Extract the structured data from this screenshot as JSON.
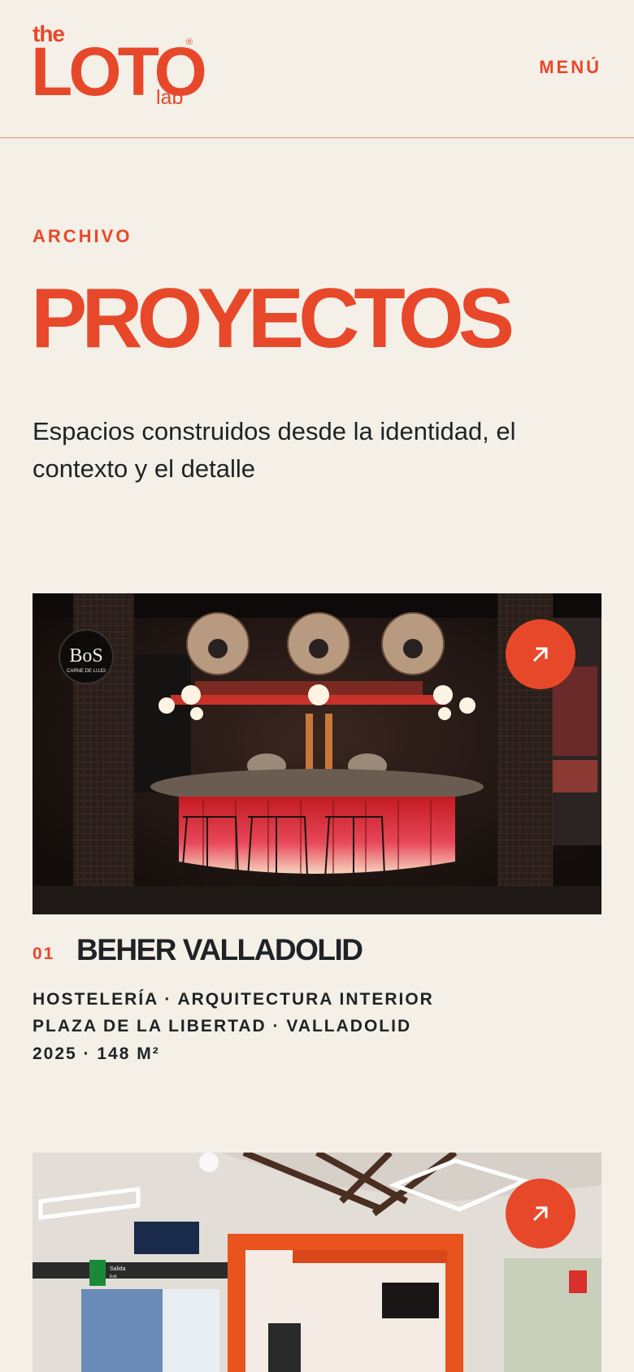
{
  "header": {
    "logo": {
      "the": "the",
      "main": "LOTO",
      "reg": "®",
      "lab": "lab"
    },
    "menu_label": "MENÚ"
  },
  "hero": {
    "eyebrow": "ARCHIVO",
    "title": "PROYECTOS",
    "subtitle": "Espacios construidos desde la identidad, el contexto y el detalle"
  },
  "projects": [
    {
      "number": "01",
      "title": "BEHER VALLADOLID",
      "meta": [
        "HOSTELERÍA · ARQUITECTURA INTERIOR",
        "PLAZA DE LA LIBERTAD · VALLADOLID",
        "2025 · 148 M²"
      ],
      "image_sign": {
        "brand": "BoS",
        "tagline": "CARNE DE LUJO"
      }
    },
    {
      "image_sign": {
        "exit_label": "Salida",
        "exit_sub": "Exit"
      }
    }
  ],
  "colors": {
    "accent": "#e8482a",
    "background": "#f4f0e8",
    "text": "#1f2326"
  },
  "icons": {
    "arrow": "arrow-up-right-icon"
  }
}
